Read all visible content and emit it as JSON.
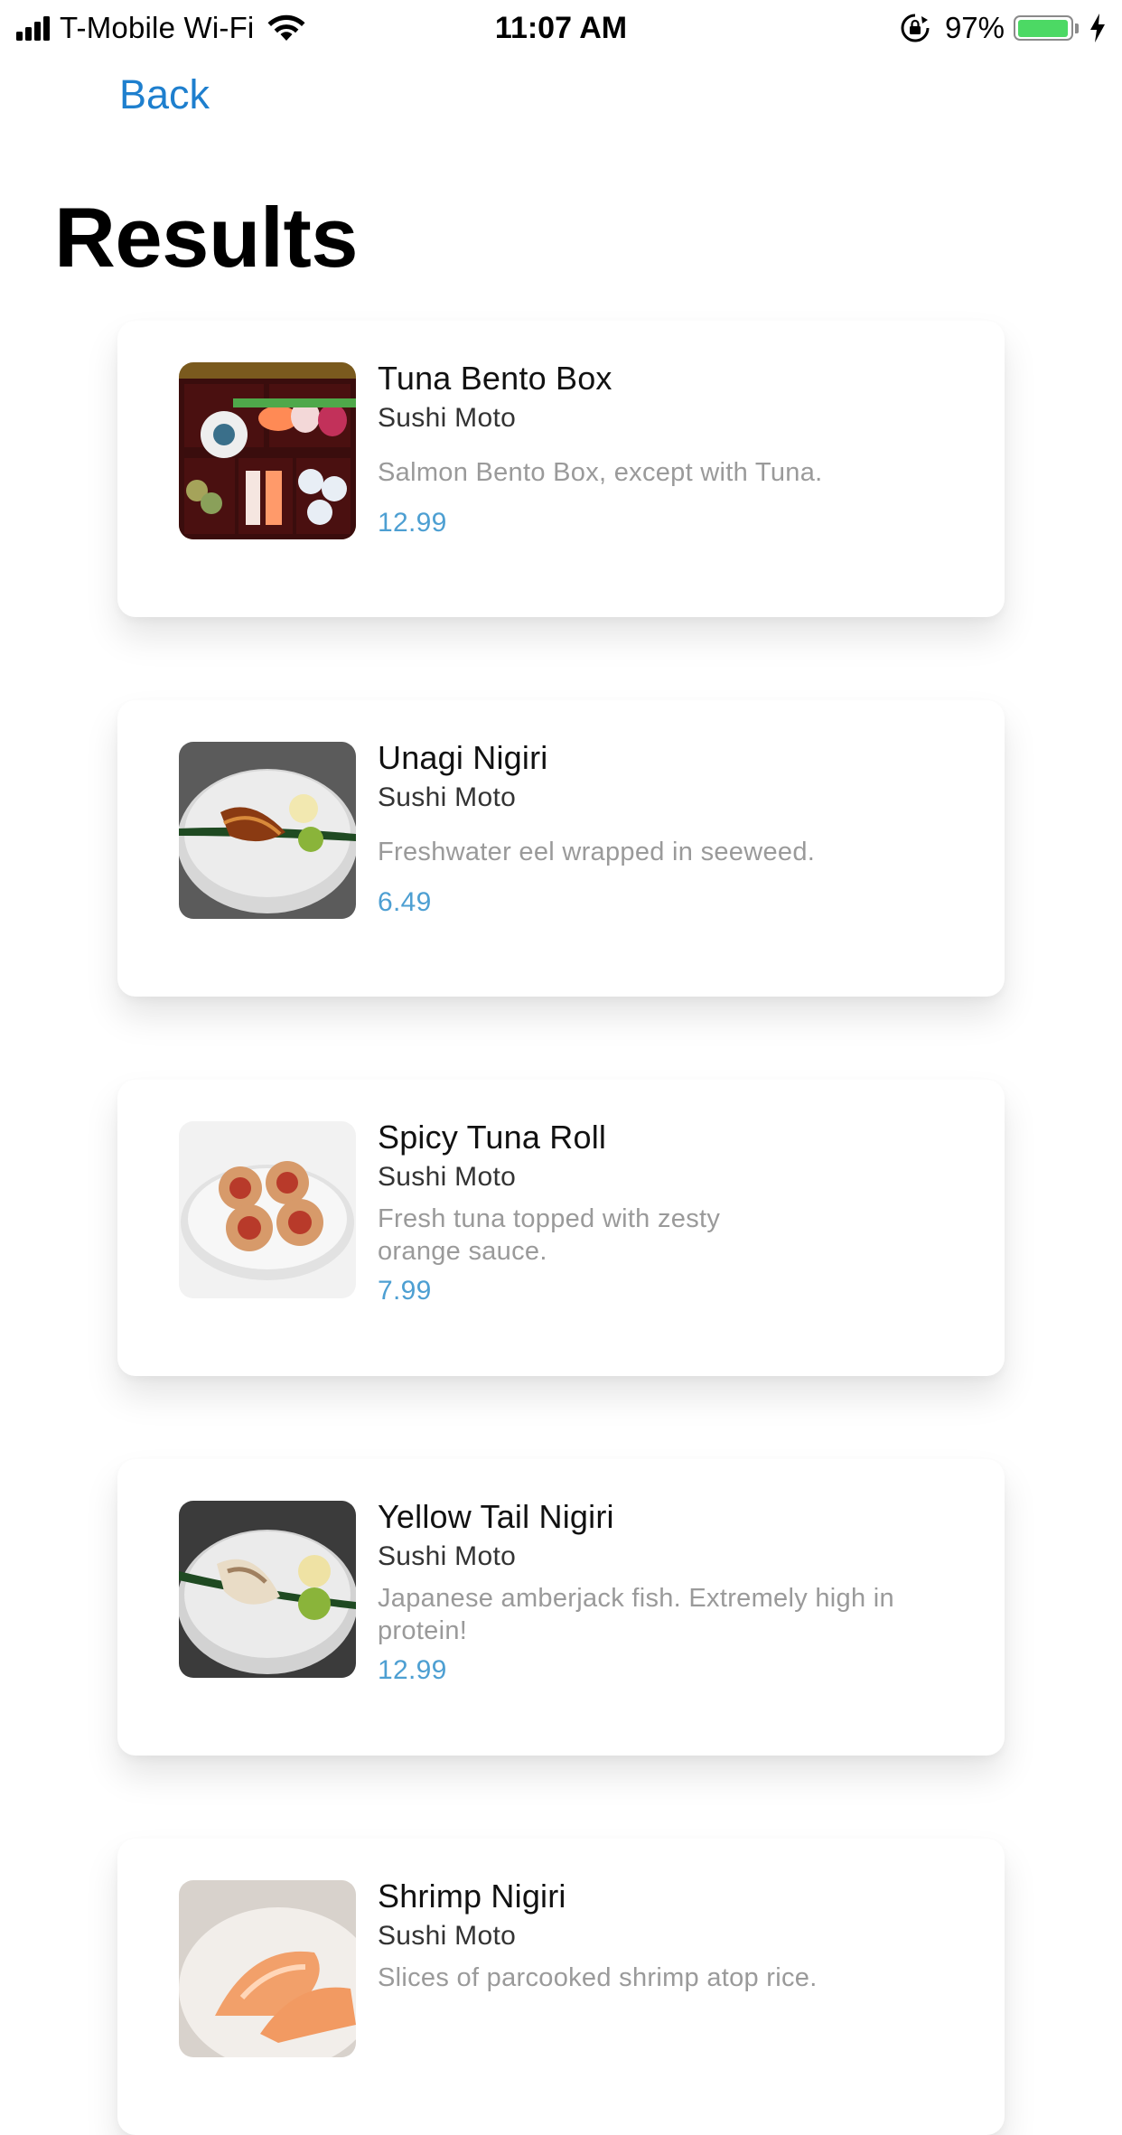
{
  "status_bar": {
    "carrier": "T-Mobile Wi-Fi",
    "time": "11:07 AM",
    "battery_percent": "97%",
    "battery_level": 0.97,
    "battery_color": "#4cd964"
  },
  "nav": {
    "back_label": "Back"
  },
  "page": {
    "title": "Results"
  },
  "accent_color": "#1e7fce",
  "price_color": "#4d9fd2",
  "results": [
    {
      "name": "Tuna Bento Box",
      "restaurant": "Sushi Moto",
      "description": "Salmon Bento Box, except with Tuna.",
      "price": "12.99",
      "image_icon": "bento-box-photo"
    },
    {
      "name": "Unagi Nigiri",
      "restaurant": "Sushi Moto",
      "description": "Freshwater eel wrapped in seeweed.",
      "price": "6.49",
      "image_icon": "unagi-nigiri-photo"
    },
    {
      "name": "Spicy Tuna Roll",
      "restaurant": "Sushi Moto",
      "description": "Fresh tuna topped with zesty orange sauce.",
      "price": "7.99",
      "image_icon": "spicy-tuna-roll-photo"
    },
    {
      "name": "Yellow Tail Nigiri",
      "restaurant": "Sushi Moto",
      "description": "Japanese amberjack fish. Extremely high in protein!",
      "price": "12.99",
      "image_icon": "yellowtail-nigiri-photo"
    },
    {
      "name": "Shrimp Nigiri",
      "restaurant": "Sushi Moto",
      "description": "Slices of parcooked shrimp atop rice.",
      "price": "",
      "image_icon": "shrimp-nigiri-photo"
    }
  ]
}
